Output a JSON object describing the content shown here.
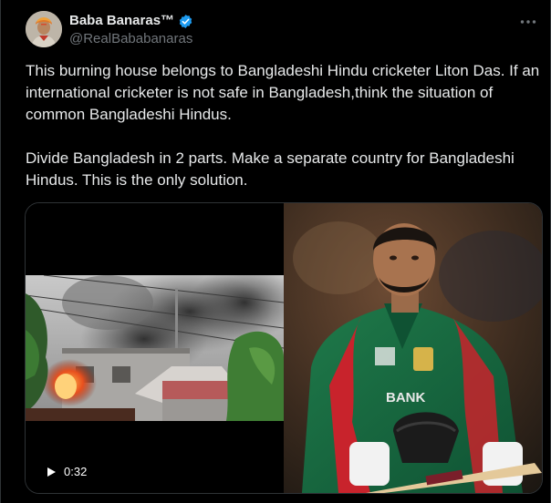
{
  "author": {
    "display_name": "Baba Banaras™",
    "handle": "@RealBababanaras",
    "verified": true,
    "avatar_icon": "profile-photo-icon"
  },
  "tweet": {
    "paragraphs": [
      "This burning house belongs to Bangladeshi Hindu cricketer Liton Das. If an international cricketer is not safe in Bangladesh,think the situation of common Bangladeshi Hindus.",
      "Divide Bangladesh in 2 parts. Make a separate country for Bangladeshi Hindus. This is the only solution."
    ]
  },
  "media": {
    "type": "video",
    "duration": "0:32",
    "play_icon": "play-icon",
    "jersey_text": "BANK"
  },
  "colors": {
    "background": "#000000",
    "text": "#e7e9ea",
    "muted": "#71767b",
    "verified_badge": "#1d9bf0",
    "border": "#2f3336"
  }
}
